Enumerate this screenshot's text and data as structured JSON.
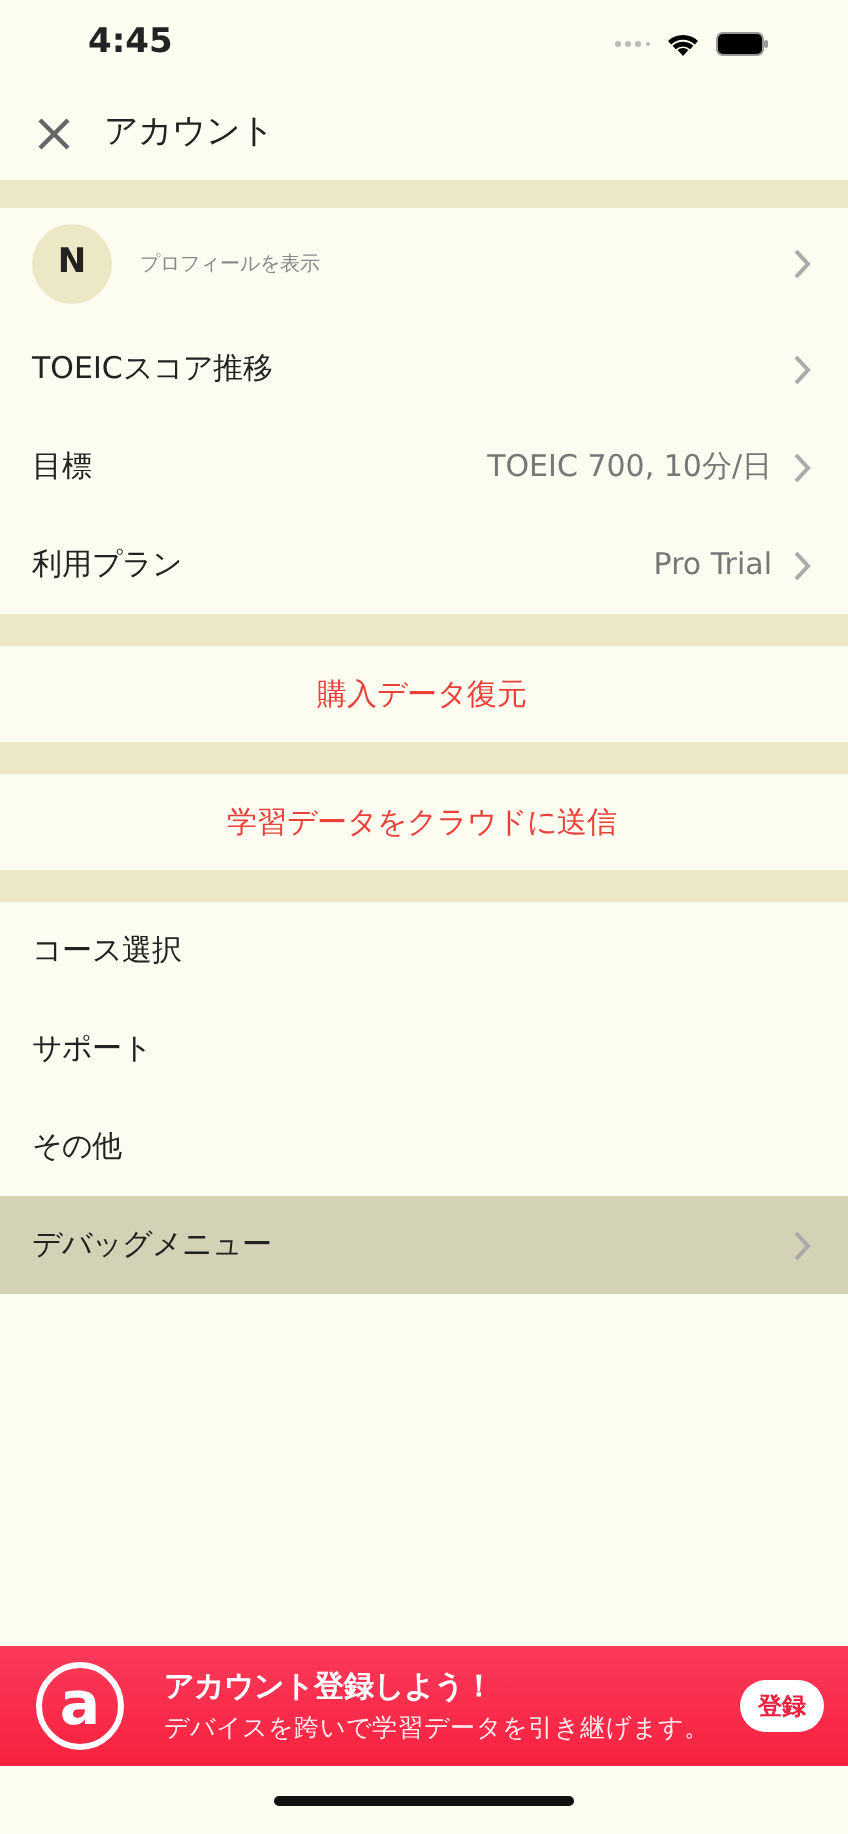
{
  "status_bar": {
    "time": "4:45"
  },
  "nav": {
    "title": "アカウント"
  },
  "sections": [
    {
      "items": [
        {
          "kind": "profile",
          "avatar": "N",
          "label": "プロフィールを表示",
          "selected": false
        },
        {
          "kind": "link",
          "label": "TOEICスコア推移",
          "selected": false
        },
        {
          "kind": "link",
          "label": "目標",
          "value": "TOEIC 700, 10分/日",
          "selected": false
        },
        {
          "kind": "link",
          "label": "利用プラン",
          "value": "Pro Trial",
          "selected": false
        }
      ]
    },
    {
      "items": [
        {
          "kind": "action",
          "label": "購入データ復元",
          "selected": false
        }
      ]
    },
    {
      "items": [
        {
          "kind": "action",
          "label": "学習データをクラウドに送信",
          "selected": false
        }
      ]
    },
    {
      "items": [
        {
          "kind": "plain",
          "label": "コース選択",
          "selected": false
        },
        {
          "kind": "plain",
          "label": "サポート",
          "selected": false
        },
        {
          "kind": "plain",
          "label": "その他",
          "selected": false
        },
        {
          "kind": "link",
          "label": "デバッグメニュー",
          "selected": true
        }
      ]
    }
  ],
  "banner": {
    "logo": "a",
    "title": "アカウント登録しよう！",
    "subtitle": "デバイスを跨いで学習データを引き継げます。",
    "button": "登録"
  }
}
